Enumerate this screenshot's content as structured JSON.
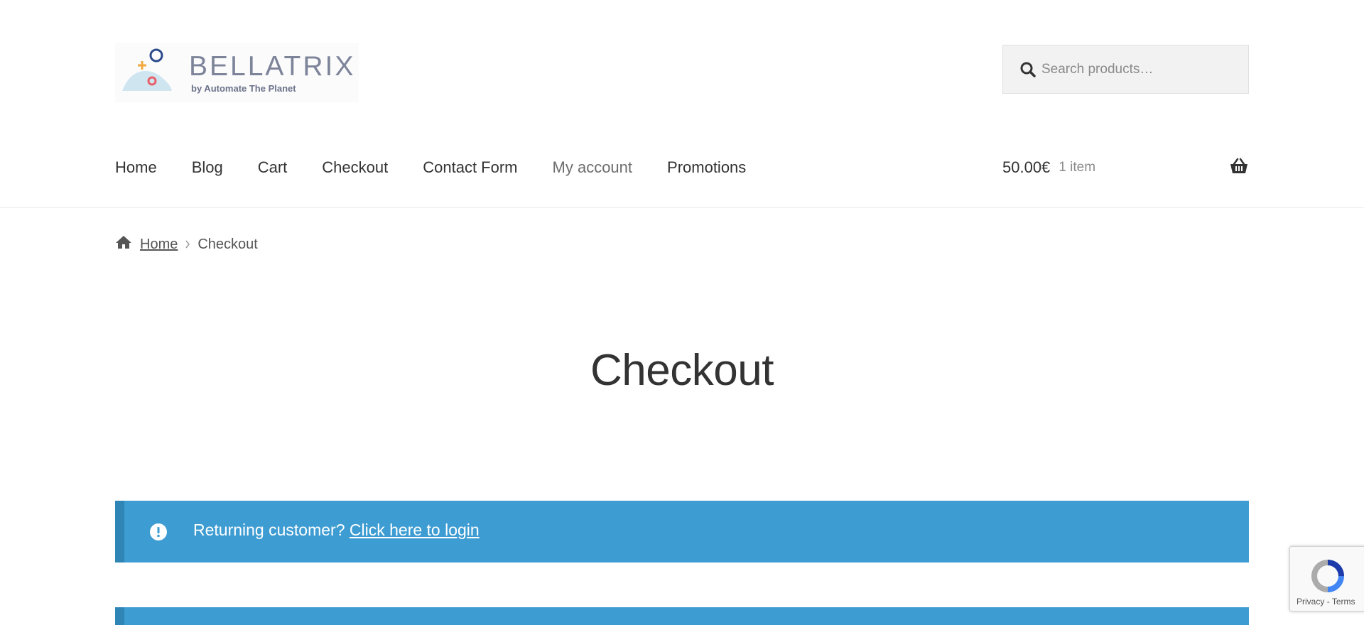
{
  "header": {
    "logo": {
      "name": "BELLATRIX",
      "tagline": "by Automate The Planet"
    },
    "search": {
      "placeholder": "Search products…"
    },
    "nav": [
      {
        "label": "Home"
      },
      {
        "label": "Blog"
      },
      {
        "label": "Cart"
      },
      {
        "label": "Checkout"
      },
      {
        "label": "Contact Form"
      },
      {
        "label": "My account",
        "active": true
      },
      {
        "label": "Promotions"
      }
    ],
    "cart": {
      "amount": "50.00€",
      "count": "1 item"
    }
  },
  "breadcrumb": {
    "home": "Home",
    "current": "Checkout"
  },
  "page": {
    "title": "Checkout"
  },
  "notices": [
    {
      "text": "Returning customer?",
      "link": "Click here to login"
    }
  ],
  "recaptcha": {
    "privacy": "Privacy",
    "separator": "-",
    "terms": "Terms"
  },
  "colors": {
    "notice_bg": "#3d9cd2",
    "notice_border": "#2f85b6",
    "text": "#333333"
  }
}
